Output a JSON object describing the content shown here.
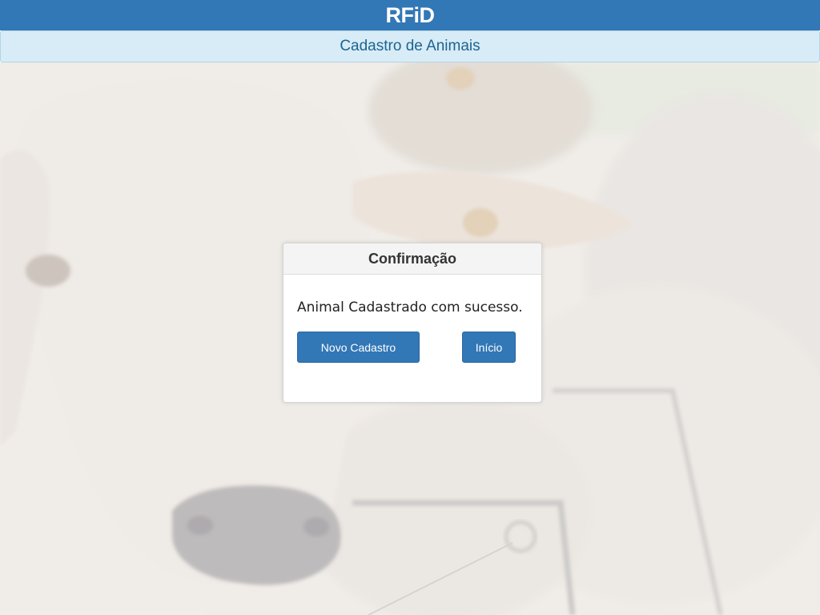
{
  "app": {
    "title": "RFiD",
    "subtitle": "Cadastro de Animais"
  },
  "background_image": {
    "subject": "cattle-photo"
  },
  "dialog": {
    "title": "Confirmação",
    "message": "Animal Cadastrado com sucesso.",
    "buttons": {
      "new_label": "Novo Cadastro",
      "home_label": "Início"
    }
  },
  "colors": {
    "primary": "#3277b6",
    "subheader_bg": "#d7ecf6",
    "subheader_text": "#1f6491"
  }
}
